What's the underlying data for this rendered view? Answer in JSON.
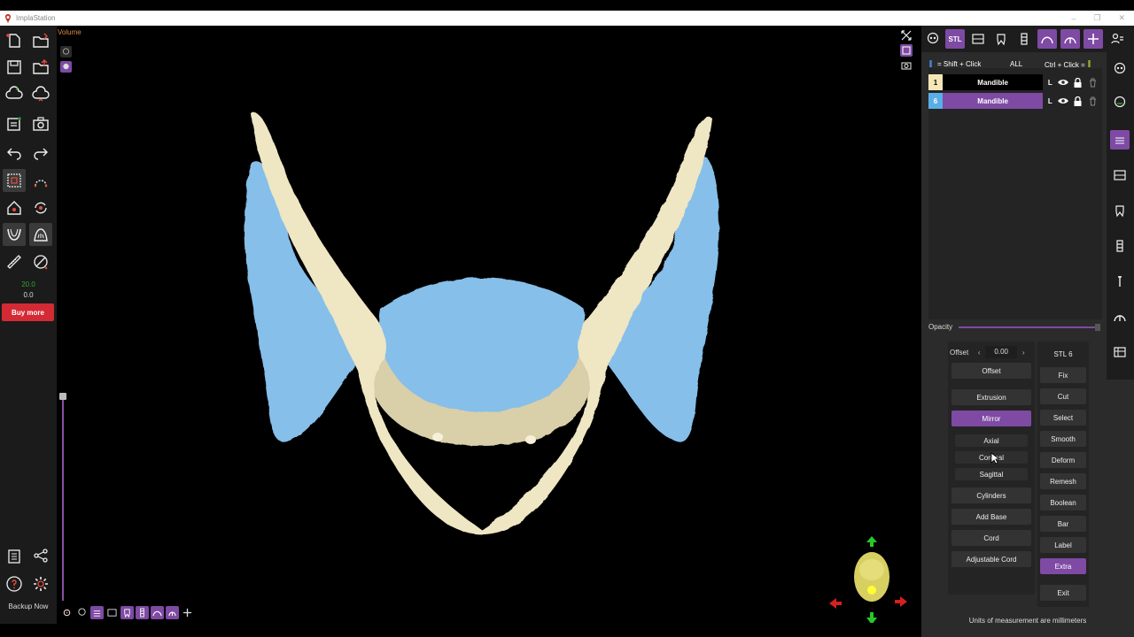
{
  "window": {
    "title": "ImplaStation",
    "minimize": "–",
    "restore": "❐",
    "close": "✕"
  },
  "left_toolbar": {
    "zoom_value_a": "20.0",
    "zoom_value_b": "0.0",
    "buy_more": "Buy more",
    "backup_now": "Backup Now"
  },
  "viewport": {
    "label": "Volume"
  },
  "right_panel": {
    "shift_click": "= Shift + Click",
    "all": "ALL",
    "ctrl_click": "Ctrl + Click =",
    "layers": [
      {
        "num": "1",
        "name": "Mandible",
        "side": "L",
        "num_color": "#f5e6b8",
        "name_color": "#000000"
      },
      {
        "num": "6",
        "name": "Mandible",
        "side": "L",
        "num_color": "#5aaee6",
        "name_color": "#7e4aa3"
      }
    ],
    "opacity_label": "Opacity",
    "offset_label": "Offset",
    "offset_value": "0.00",
    "left_tools": {
      "offset": "Offset",
      "extrusion": "Extrusion",
      "mirror": "Mirror",
      "axial": "Axial",
      "coronal": "Coronal",
      "sagittal": "Sagittal",
      "cylinders": "Cylinders",
      "add_base": "Add Base",
      "cord": "Cord",
      "adjustable_cord": "Adjustable Cord"
    },
    "right_tools": {
      "stl": "STL 6",
      "fix": "Fix",
      "cut": "Cut",
      "select": "Select",
      "smooth": "Smooth",
      "deform": "Deform",
      "remesh": "Remesh",
      "boolean": "Boolean",
      "bar": "Bar",
      "label": "Label",
      "extra": "Extra",
      "exit": "Exit"
    },
    "stl_tab": "STL",
    "units_note": "Units of measurement are millimeters"
  },
  "colors": {
    "accent": "#7e4aa3",
    "bone": "#efe6c4",
    "mirror_blue": "#86bfe9",
    "buy": "#d42a35"
  }
}
